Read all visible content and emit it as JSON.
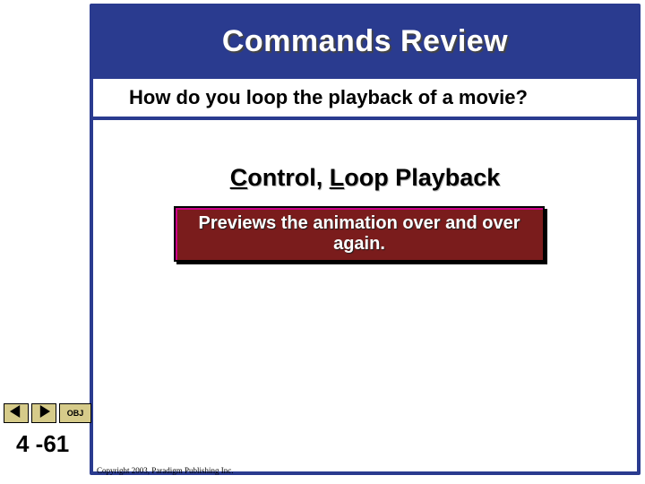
{
  "title": "Commands Review",
  "question": "How do you loop the playback of a movie?",
  "answer": {
    "u1": "C",
    "p1": "ontrol, ",
    "u2": "L",
    "p2": "oop Playback"
  },
  "definition": "Previews the animation over and over again.",
  "nav": {
    "obj_label": "OBJ"
  },
  "page_number": "4 -61",
  "copyright": "Copyright 2003, Paradigm Publishing Inc."
}
